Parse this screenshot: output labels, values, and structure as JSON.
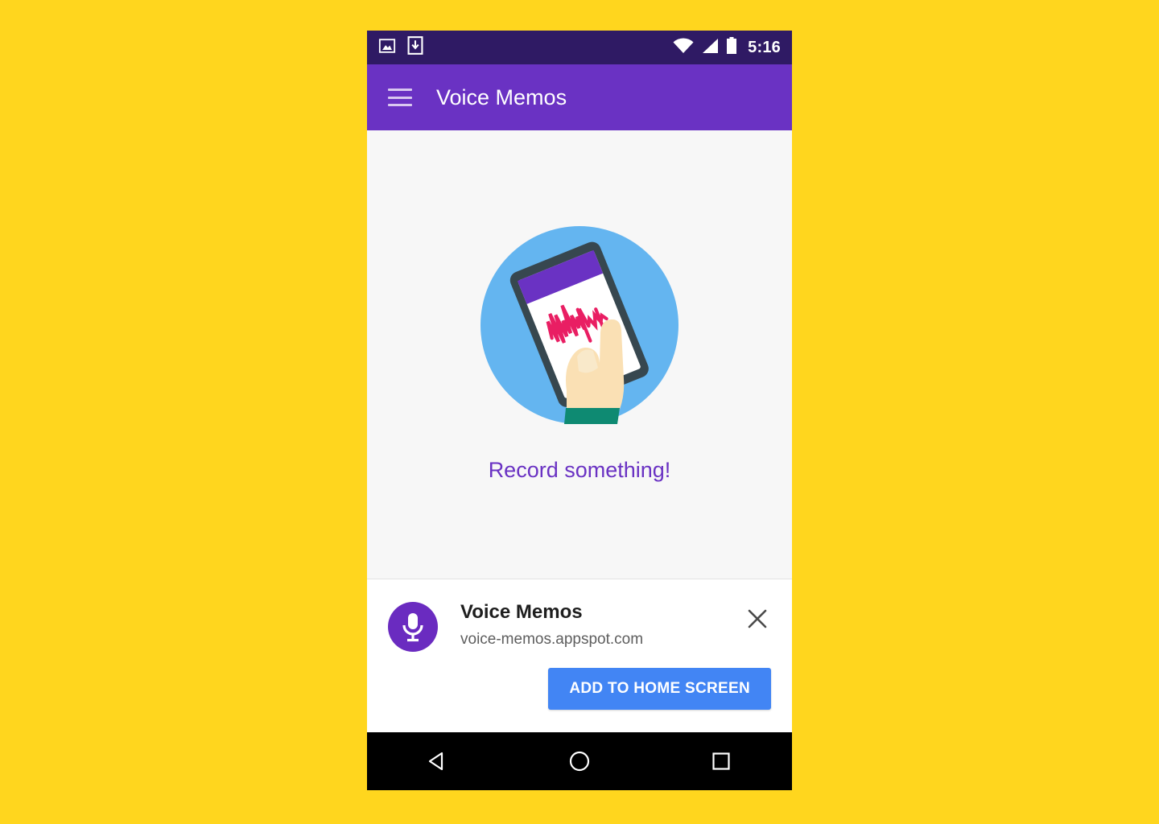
{
  "page": {
    "background_color": "#FFD61E"
  },
  "status_bar": {
    "background_color": "#2F1A64",
    "time": "5:16",
    "left_icons": [
      "image-icon",
      "download-icon"
    ],
    "right_icons": [
      "wifi-icon",
      "cellular-signal-icon",
      "battery-icon"
    ]
  },
  "app_bar": {
    "background_color": "#6A32C3",
    "menu_icon": "hamburger-menu-icon",
    "title": "Voice Memos"
  },
  "main": {
    "background_color": "#F7F7F7",
    "illustration": "hand-holding-phone-with-waveform-illustration",
    "illustration_colors": {
      "circle": "#64B5F0",
      "phone_body": "#37474F",
      "phone_header": "#6A32C3",
      "waveform": "#E91E63",
      "skin": "#FAE0B4",
      "sleeve": "#0E8A72"
    },
    "empty_state_text": "Record something!",
    "empty_state_color": "#6A32C3"
  },
  "install_banner": {
    "app_icon": "microphone-icon",
    "app_icon_background": "#6A2BC0",
    "title": "Voice Memos",
    "url": "voice-memos.appspot.com",
    "close_icon": "close-icon",
    "add_button_label": "ADD TO HOME SCREEN",
    "add_button_color": "#4285F4"
  },
  "nav_bar": {
    "background_color": "#000000",
    "buttons": [
      {
        "name": "back",
        "icon": "back-triangle-icon"
      },
      {
        "name": "home",
        "icon": "home-circle-icon"
      },
      {
        "name": "recents",
        "icon": "recents-square-icon"
      }
    ]
  }
}
